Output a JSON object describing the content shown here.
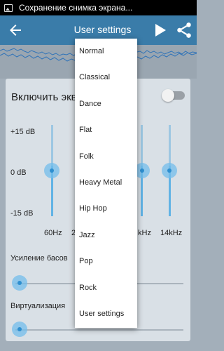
{
  "status_bar": {
    "notification_text": "Сохранение снимка экрана..."
  },
  "action_bar": {
    "title": "User settings"
  },
  "equalizer": {
    "enable_label": "Включить эквалайзер",
    "enabled": false,
    "db_labels": {
      "top": "+15 dB",
      "mid": "0 dB",
      "bottom": "-15 dB"
    },
    "visible_frequencies": [
      "60Hz",
      "2",
      "kHz",
      "14kHz"
    ],
    "bass_label": "Усиление басов",
    "virtualization_label": "Виртуализация"
  },
  "dropdown": {
    "items": [
      "Normal",
      "Classical",
      "Dance",
      "Flat",
      "Folk",
      "Heavy Metal",
      "Hip Hop",
      "Jazz",
      "Pop",
      "Rock",
      "User settings"
    ]
  },
  "colors": {
    "action_bar": "#3a7ca9",
    "accent": "#61b3e5",
    "card": "#d9e0e6"
  }
}
